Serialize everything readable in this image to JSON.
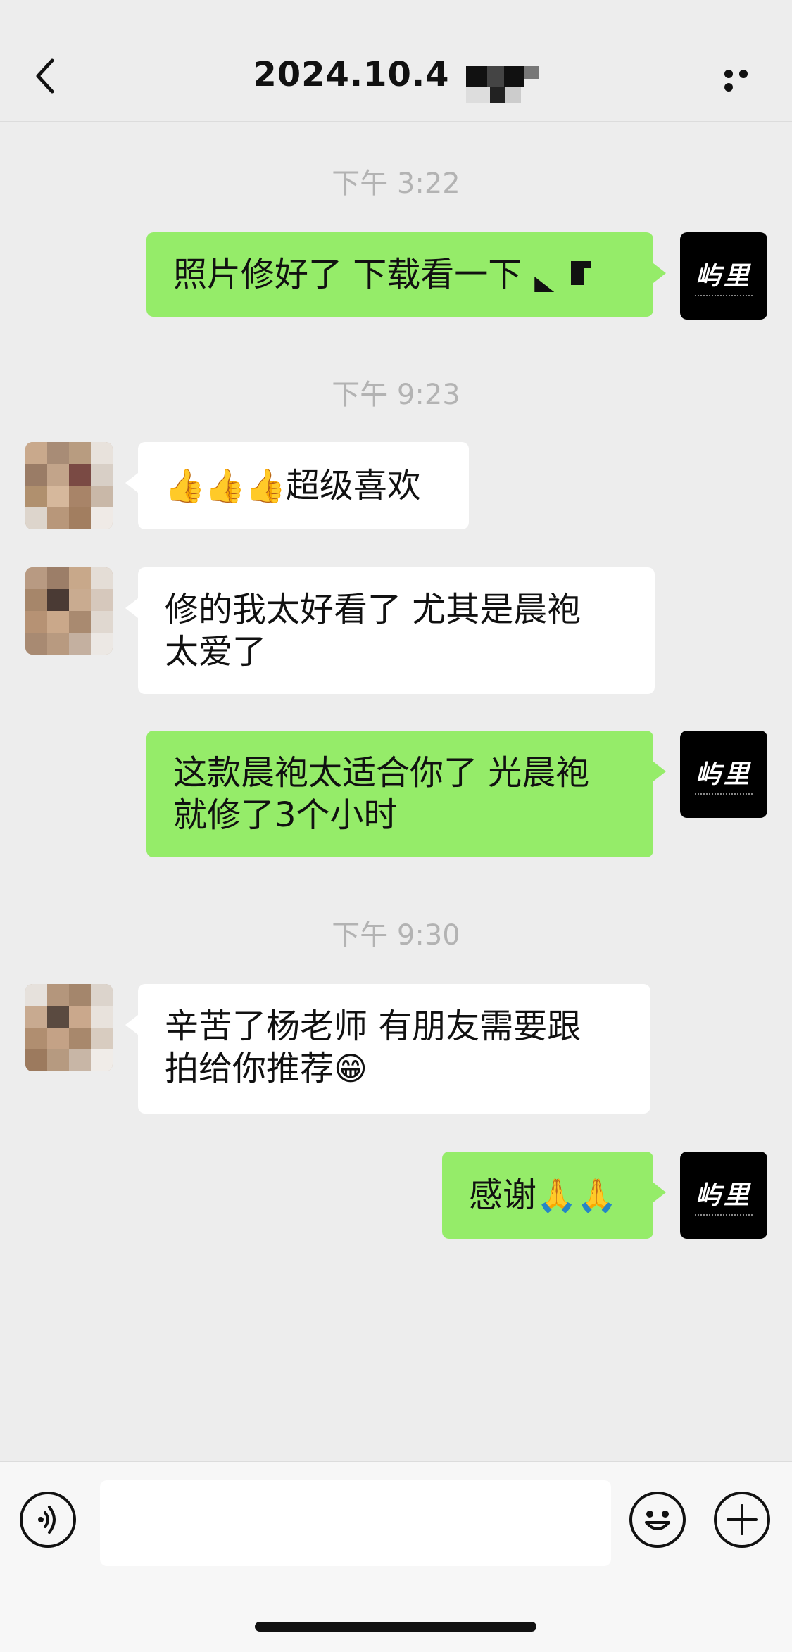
{
  "header": {
    "title": "2024.10.4",
    "back_icon": "chevron-left-icon",
    "more_icon": "more-dots-icon"
  },
  "messages": [
    {
      "type": "time",
      "text": "下午 3:22"
    },
    {
      "type": "msg",
      "side": "right",
      "sender": "brand",
      "text": "照片修好了 下载看一下"
    },
    {
      "type": "time",
      "text": "下午 9:23"
    },
    {
      "type": "msg",
      "side": "left",
      "sender": "contact",
      "emoji": "👍👍👍",
      "text": "超级喜欢"
    },
    {
      "type": "msg",
      "side": "left",
      "sender": "contact",
      "line1": "修的我太好看了  尤其是晨袍",
      "line2": "太爱了"
    },
    {
      "type": "msg",
      "side": "right",
      "sender": "brand",
      "line1": "这款晨袍太适合你了  光晨袍",
      "line2": "就修了3个小时"
    },
    {
      "type": "time",
      "text": "下午 9:30"
    },
    {
      "type": "msg",
      "side": "left",
      "sender": "contact",
      "line1": "辛苦了杨老师   有朋友需要跟",
      "line2": "拍给你推荐",
      "emoji": "😁"
    },
    {
      "type": "msg",
      "side": "right",
      "sender": "brand",
      "text": "感谢",
      "emoji": "🙏🙏"
    }
  ],
  "brand_avatar": {
    "text": "屿里",
    "bg": "#000000"
  },
  "footer": {
    "voice_icon": "voice-icon",
    "emoji_icon": "smiley-icon",
    "plus_icon": "plus-icon",
    "input_value": ""
  },
  "colors": {
    "background": "#ededed",
    "bubble_self": "#95ec69",
    "bubble_other": "#ffffff",
    "timestamp": "#b3b3b3"
  }
}
